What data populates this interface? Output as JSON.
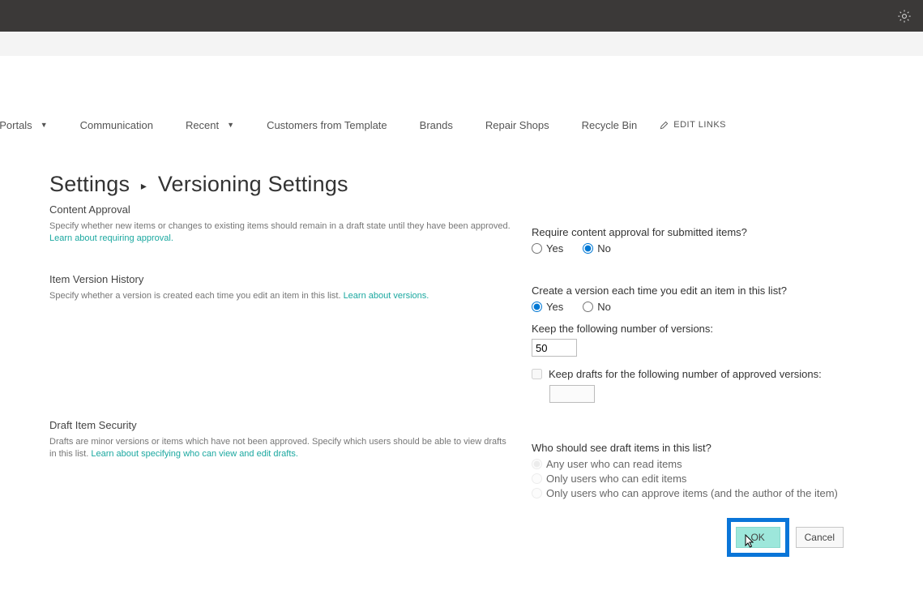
{
  "nav": {
    "items": [
      {
        "label": "t Portals",
        "caret": true
      },
      {
        "label": "Communication",
        "caret": false
      },
      {
        "label": "Recent",
        "caret": true
      },
      {
        "label": "Customers from Template",
        "caret": false
      },
      {
        "label": "Brands",
        "caret": false
      },
      {
        "label": "Repair Shops",
        "caret": false
      },
      {
        "label": "Recycle Bin",
        "caret": false
      }
    ],
    "edit_links_label": "EDIT LINKS"
  },
  "breadcrumb": {
    "root": "Settings",
    "current": "Versioning Settings"
  },
  "sections": {
    "content_approval": {
      "title": "Content Approval",
      "desc": "Specify whether new items or changes to existing items should remain in a draft state until they have been approved.  ",
      "learn": "Learn about requiring approval.",
      "question": "Require content approval for submitted items?",
      "yes": "Yes",
      "no": "No",
      "selected": "no"
    },
    "version_history": {
      "title": "Item Version History",
      "desc": "Specify whether a version is created each time you edit an item in this list.  ",
      "learn": "Learn about versions.",
      "question": "Create a version each time you edit an item in this list?",
      "yes": "Yes",
      "no": "No",
      "selected": "yes",
      "keep_versions_label": "Keep the following number of versions:",
      "keep_versions_value": "50",
      "keep_drafts_label": "Keep drafts for the following number of approved versions:",
      "keep_drafts_value": ""
    },
    "draft_security": {
      "title": "Draft Item Security",
      "desc": "Drafts are minor versions or items which have not been approved. Specify which users should be able to view drafts in this list.  ",
      "learn": "Learn about specifying who can view and edit drafts.",
      "question": "Who should see draft items in this list?",
      "opt1": "Any user who can read items",
      "opt2": "Only users who can edit items",
      "opt3": "Only users who can approve items (and the author of the item)"
    }
  },
  "buttons": {
    "ok": "OK",
    "cancel": "Cancel"
  }
}
